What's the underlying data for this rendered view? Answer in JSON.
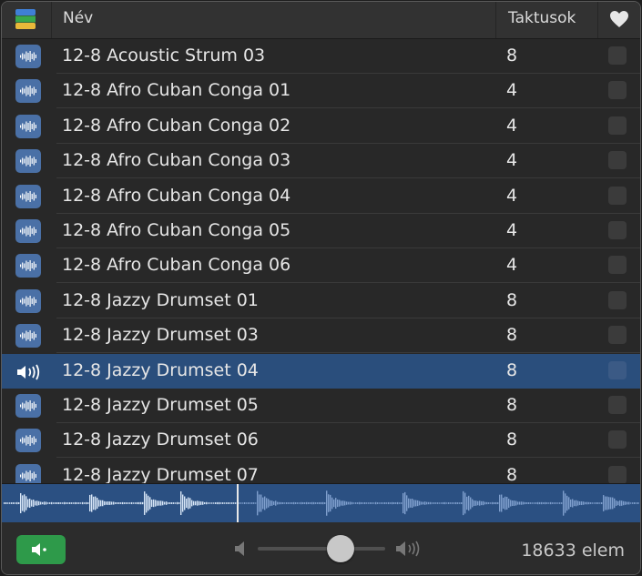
{
  "header": {
    "name_label": "Név",
    "beats_label": "Taktusok"
  },
  "rows": [
    {
      "name": "12-8 Acoustic Strum 03",
      "beats": "8",
      "icon": "audio-waveform-icon"
    },
    {
      "name": "12-8 Afro Cuban Conga 01",
      "beats": "4",
      "icon": "audio-waveform-icon"
    },
    {
      "name": "12-8 Afro Cuban Conga 02",
      "beats": "4",
      "icon": "audio-waveform-icon"
    },
    {
      "name": "12-8 Afro Cuban Conga 03",
      "beats": "4",
      "icon": "audio-waveform-icon"
    },
    {
      "name": "12-8 Afro Cuban Conga 04",
      "beats": "4",
      "icon": "audio-waveform-icon"
    },
    {
      "name": "12-8 Afro Cuban Conga 05",
      "beats": "4",
      "icon": "audio-waveform-icon"
    },
    {
      "name": "12-8 Afro Cuban Conga 06",
      "beats": "4",
      "icon": "audio-waveform-icon"
    },
    {
      "name": "12-8 Jazzy Drumset 01",
      "beats": "8",
      "icon": "audio-waveform-icon"
    },
    {
      "name": "12-8 Jazzy Drumset 03",
      "beats": "8",
      "icon": "audio-waveform-icon"
    },
    {
      "name": "12-8 Jazzy Drumset 04",
      "beats": "8",
      "icon": "speaker-playing-icon",
      "selected": true
    },
    {
      "name": "12-8 Jazzy Drumset 05",
      "beats": "8",
      "icon": "audio-waveform-icon"
    },
    {
      "name": "12-8 Jazzy Drumset 06",
      "beats": "8",
      "icon": "audio-waveform-icon"
    },
    {
      "name": "12-8 Jazzy Drumset 07",
      "beats": "8",
      "icon": "audio-waveform-icon"
    }
  ],
  "footer": {
    "item_count": "18633 elem",
    "volume_level": 0.65
  },
  "colors": {
    "selection": "#2a4e7c",
    "audio_icon": "#4a70a6",
    "preview_button": "#2e9a4a"
  }
}
